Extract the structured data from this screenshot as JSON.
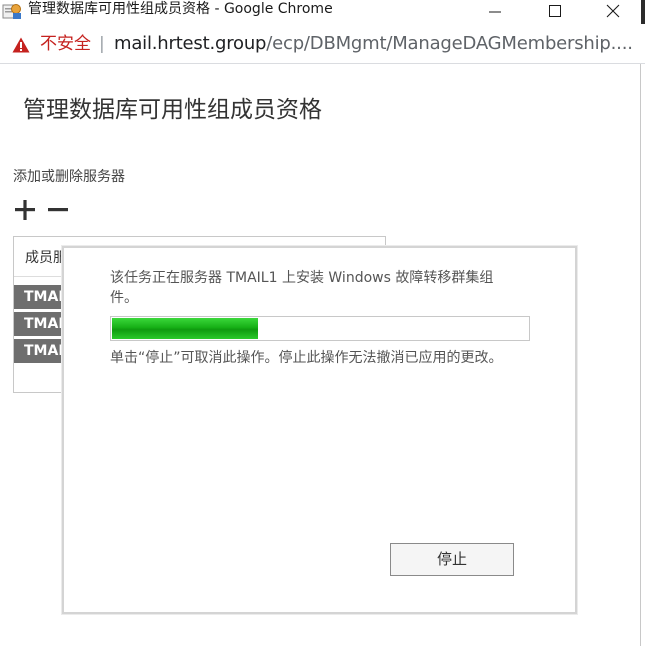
{
  "window": {
    "title": "管理数据库可用性组成员资格 - Google Chrome",
    "controls": {
      "minimize": "minimize-icon",
      "maximize": "maximize-icon",
      "close": "close-icon"
    }
  },
  "address_bar": {
    "security_label": "不安全",
    "separator": "|",
    "url_host": "mail.hrtest.group",
    "url_path": "/ecp/DBMgmt/ManageDAGMembership...."
  },
  "page": {
    "title": "管理数据库可用性组成员资格",
    "section_label": "添加或删除服务器",
    "toolbar": {
      "add_icon": "plus-icon",
      "remove_icon": "minus-icon"
    },
    "table": {
      "column_header": "成员服",
      "rows": [
        "TMAIL",
        "TMAIL",
        "TMAIL"
      ]
    }
  },
  "dialog": {
    "message": "该任务正在服务器 TMAIL1 上安装 Windows 故障转移群集组件。",
    "progress": 0.35,
    "note": "单击“停止”可取消此操作。停止此操作无法撤消已应用的更改。",
    "stop_label": "停止"
  },
  "colors": {
    "warning": "#c5221f",
    "progress": "#16b016",
    "row_background": "#6e6e6e"
  }
}
